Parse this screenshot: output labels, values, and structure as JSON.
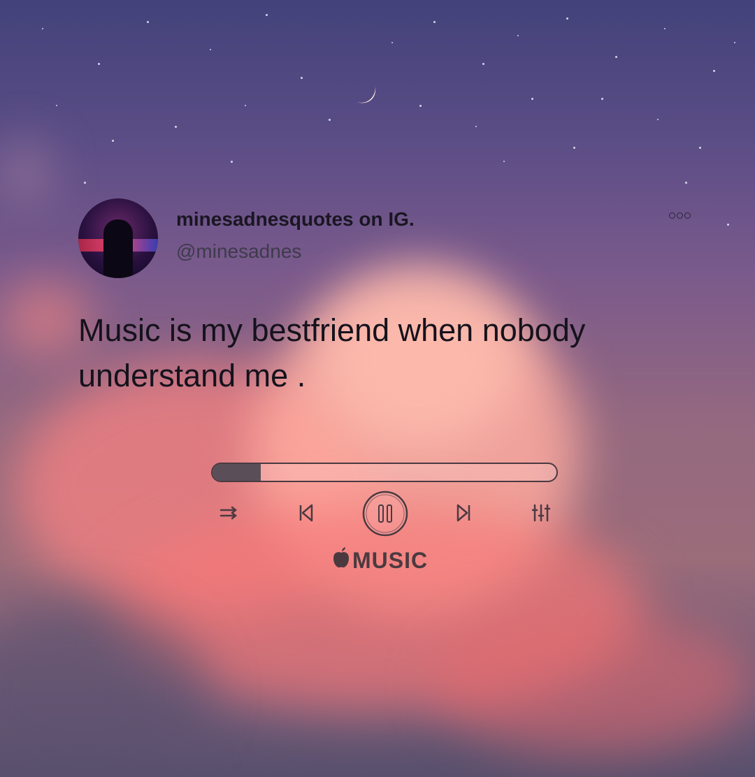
{
  "post": {
    "display_name": "minesadnesquotes on IG.",
    "handle": "@minesadnes",
    "text": "Music is my bestfriend when nobody understand me ."
  },
  "player": {
    "progress": 0.14,
    "brand_label": "MUSIC",
    "brand_logo": "apple-logo-icon",
    "controls": [
      "shuffle-icon",
      "previous-icon",
      "pause-icon",
      "next-icon",
      "equalizer-icon"
    ]
  },
  "colors": {
    "text": "#15121c",
    "handle": "#3f3a4c",
    "player_stroke": "#4a3a42"
  }
}
